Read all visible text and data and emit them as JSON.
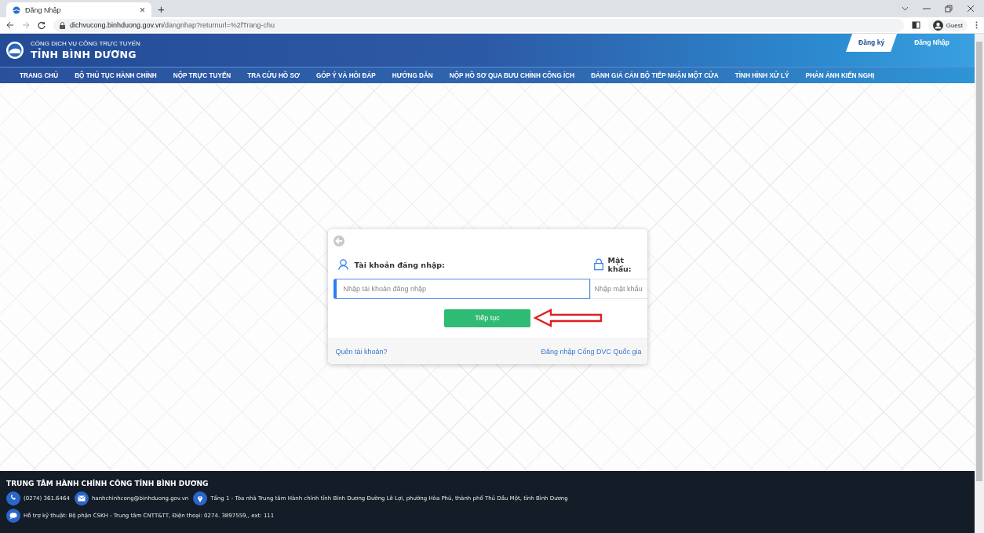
{
  "browser": {
    "tab_title": "Đăng Nhập",
    "tab_close": "×",
    "new_tab": "+",
    "url": "dichvucong.binhduong.gov.vn/dangnhap?returnurl=%2fTrang-chu",
    "profile": "Guest"
  },
  "header": {
    "subtitle": "CỔNG DỊCH VỤ CÔNG TRỰC TUYẾN",
    "title": "TỈNH BÌNH DƯƠNG",
    "auth_links": [
      {
        "label": "Đăng ký",
        "selected": true
      },
      {
        "label": "Đăng Nhập",
        "selected": false
      }
    ]
  },
  "nav": {
    "items": [
      "TRANG CHỦ",
      "BỘ THỦ TỤC HÀNH CHÍNH",
      "NỘP TRỰC TUYẾN",
      "TRA CỨU HỒ SƠ",
      "GÓP Ý VÀ HỎI ĐÁP",
      "HƯỚNG DẪN",
      "NỘP HỒ SƠ QUA BƯU CHÍNH CÔNG ÍCH",
      "ĐÁNH GIÁ CÁN BỘ TIẾP NHẬN MỘT CỬA",
      "TÌNH HÌNH XỬ LÝ",
      "PHẢN ÁNH KIẾN NGHỊ"
    ]
  },
  "login": {
    "username_label": "Tài khoản đăng nhập:",
    "username_placeholder": "Nhập tài khoản đăng nhập",
    "password_label": "Mật khẩu:",
    "password_placeholder": "Nhập mật khẩu",
    "continue_button": "Tiếp tục",
    "forgot_link": "Quên tài khoản?",
    "national_link": "Đăng nhập Cổng DVC Quốc gia"
  },
  "footer": {
    "title": "TRUNG TÂM HÀNH CHÍNH CÔNG TỈNH BÌNH DƯƠNG",
    "contacts": [
      {
        "kind": "phone",
        "text": "(0274) 361.6464"
      },
      {
        "kind": "email",
        "text": "hanhchinhcong@binhduong.gov.vn"
      },
      {
        "kind": "location",
        "text": "Tầng 1 - Tòa nhà Trung tâm Hành chính tỉnh Bình Dương Đường Lê Lợi, phường Hòa Phú, thành phố Thủ Dầu Một, tỉnh Bình Dương"
      },
      {
        "kind": "chat",
        "text": "Hỗ trợ kỹ thuật: Bộ phận CSKH - Trung tâm CNTT&TT, Điện thoại: 0274. 3897559,, ext: 111"
      }
    ]
  }
}
